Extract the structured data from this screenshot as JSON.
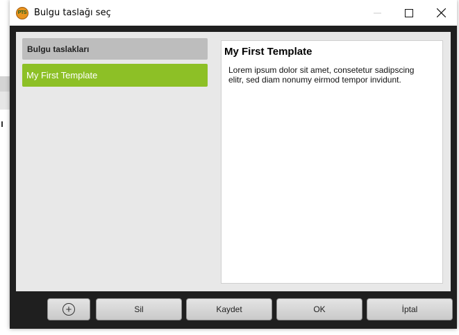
{
  "window": {
    "title": "Bulgu taslağı seç",
    "icon_text": "PTS",
    "controls": [
      "minimize-icon",
      "maximize-icon",
      "close-icon"
    ]
  },
  "list": {
    "header": "Bulgu taslakları",
    "items": [
      {
        "label": "My First Template",
        "selected": true
      }
    ],
    "selected_color": "#8dc026"
  },
  "preview": {
    "title": "My First Template",
    "body": "Lorem ipsum dolor sit amet, consetetur sadipscing elitr, sed diam nonumy eirmod tempor invidunt."
  },
  "buttons": {
    "add_icon": "plus-circle-icon",
    "delete": "Sil",
    "save": "Kaydet",
    "ok": "OK",
    "cancel": "İptal"
  }
}
